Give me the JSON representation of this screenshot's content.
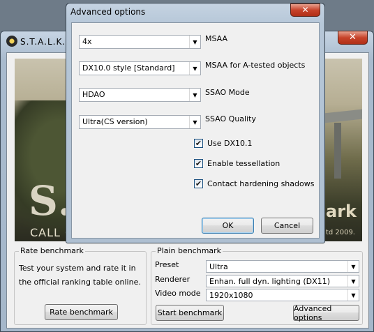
{
  "main_window": {
    "title": "S.T.A.L.K.E.R",
    "close_label": "✕",
    "banner": {
      "logo": "S.T.",
      "tagline": "CALL O",
      "mark": "mark",
      "copyright": "...td 2009."
    }
  },
  "rate_benchmark": {
    "legend": "Rate benchmark",
    "description": "Test your system and rate it in the official ranking table online.",
    "button_label": "Rate benchmark"
  },
  "plain_benchmark": {
    "legend": "Plain benchmark",
    "preset": {
      "label": "Preset",
      "value": "Ultra"
    },
    "renderer": {
      "label": "Renderer",
      "value": "Enhan. full dyn. lighting (DX11)"
    },
    "video_mode": {
      "label": "Video mode",
      "value": "1920x1080"
    },
    "start_label": "Start benchmark",
    "advanced_label": "Advanced options"
  },
  "dialog": {
    "title": "Advanced options",
    "close_label": "✕",
    "selects": [
      {
        "value": "4x",
        "label": "MSAA"
      },
      {
        "value": "DX10.0 style [Standard]",
        "label": "MSAA for A-tested objects"
      },
      {
        "value": "HDAO",
        "label": "SSAO Mode"
      },
      {
        "value": "Ultra(CS version)",
        "label": "SSAO Quality"
      }
    ],
    "checkboxes": [
      {
        "label": "Use DX10.1",
        "checked": true
      },
      {
        "label": "Enable tessellation",
        "checked": true
      },
      {
        "label": "Contact hardening shadows",
        "checked": true
      }
    ],
    "ok_label": "OK",
    "cancel_label": "Cancel",
    "check_mark": "✔"
  },
  "colors": {
    "title_bar": "#b6c7d8",
    "close_button": "#c7432a",
    "surface": "#f0f0f0"
  }
}
